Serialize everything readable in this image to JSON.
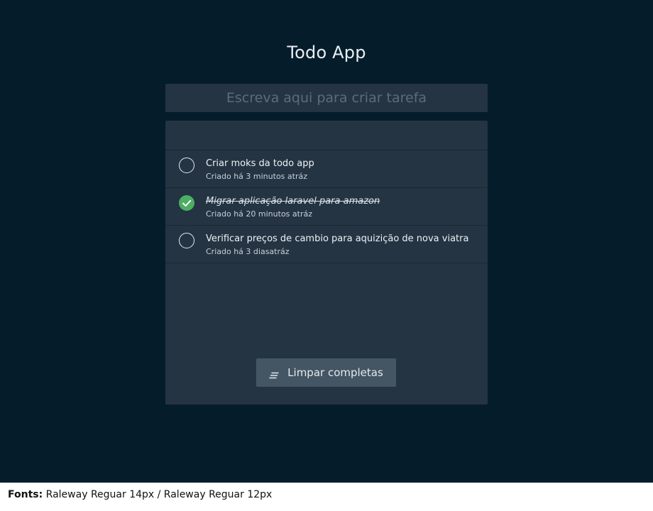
{
  "app": {
    "title": "Todo App"
  },
  "new_task": {
    "placeholder": "Escreva aqui para criar tarefa"
  },
  "tasks": [
    {
      "title": "Criar moks da todo app",
      "meta": "Criado há 3 minutos atráz",
      "completed": false
    },
    {
      "title": "Migrar aplicação laravel para amazon",
      "meta": "Criado há 20 minutos atráz",
      "completed": true
    },
    {
      "title": "Verificar preços de cambio para aquizição de nova viatra",
      "meta": "Criado há 3 diasatráz",
      "completed": false
    }
  ],
  "actions": {
    "clear_completed_label": "Limpar completas",
    "clear_icon": "clear-list-icon"
  },
  "footnote": {
    "label": "Fonts:",
    "text": "Raleway Reguar 14px / Raleway Reguar 12px"
  },
  "colors": {
    "background": "#051c2b",
    "panel": "#243443",
    "button": "#445564",
    "done_check": "#4caf62"
  }
}
